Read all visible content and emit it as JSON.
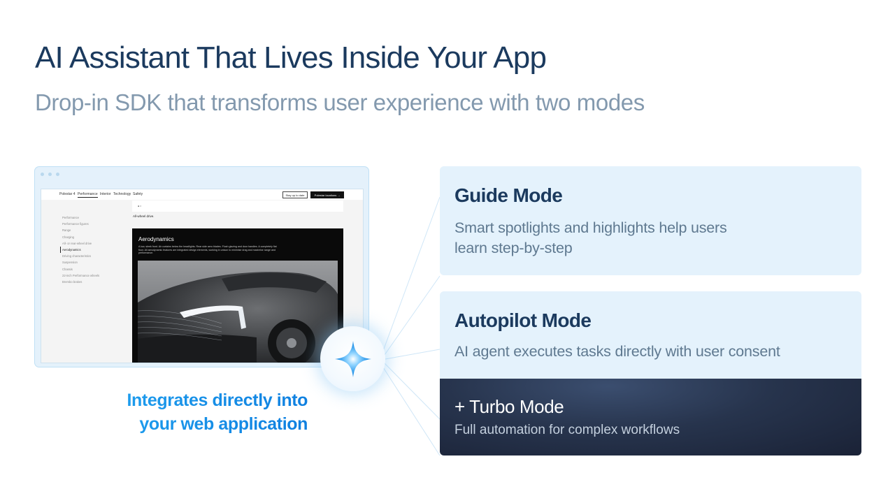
{
  "header": {
    "title": "AI Assistant That Lives Inside Your App",
    "subtitle": "Drop-in SDK that transforms user experience with two modes"
  },
  "mockup": {
    "nav_items": [
      "Polestar 4",
      "Performance",
      "Interior",
      "Technology",
      "Safety"
    ],
    "active_nav": "Performance",
    "btn_stay": "Stay up to date",
    "btn_locations": "Polestar locations →",
    "pager": "● ○",
    "awd_label": "All-wheel drive.",
    "sidebar_items": [
      "Performance",
      "Performance figures",
      "Range",
      "Charging",
      "All- or rear-wheel drive",
      "Aerodynamics",
      "Driving characteristics",
      "Suspension",
      "Chassis",
      "22-inch Performance wheels",
      "Brembo brakes"
    ],
    "active_sidebar": "Aerodynamics",
    "hero_title": "Aerodynamics",
    "hero_text": "A low, sleek front. Air curtains below the headlights. Rear side aero blades. Flush glazing and door handles. A completely flat floor. All aerodynamic features are integrated design elements, working in unison to minimise drag and maximise range and performance."
  },
  "caption": {
    "line1": "Integrates directly into",
    "line2": "your web application"
  },
  "modes": {
    "guide": {
      "title": "Guide Mode",
      "description": "Smart spotlights and highlights help users learn step-by-step"
    },
    "autopilot": {
      "title": "Autopilot Mode",
      "description": "AI agent executes tasks directly with user consent"
    },
    "turbo": {
      "title": "+ Turbo Mode",
      "description": "Full automation for complex workflows"
    }
  },
  "icons": {
    "assistant": "sparkle-star-icon"
  },
  "colors": {
    "title": "#1b3a5e",
    "subtitle": "#8399ae",
    "accent": "#1fa0ef",
    "card_bg": "#e4f2fc",
    "turbo_bg": "#1f2a40"
  }
}
